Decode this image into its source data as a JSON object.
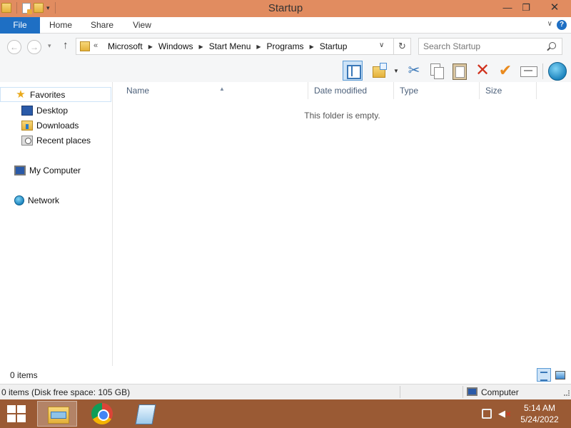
{
  "window": {
    "title": "Startup",
    "controls": {
      "minimize": "—",
      "maximize": "❐",
      "close": "✕"
    }
  },
  "ribbon": {
    "tabs": [
      {
        "label": "File"
      },
      {
        "label": "Home"
      },
      {
        "label": "Share"
      },
      {
        "label": "View"
      }
    ],
    "help": "?"
  },
  "address": {
    "overflow": "«",
    "breadcrumbs": [
      "Microsoft",
      "Windows",
      "Start Menu",
      "Programs",
      "Startup"
    ]
  },
  "search": {
    "placeholder": "Search Startup"
  },
  "toolbar": {
    "icons": [
      "preview-pane-icon",
      "new-folder-icon",
      "cut-icon",
      "copy-icon",
      "paste-icon",
      "delete-icon",
      "check-icon",
      "rename-icon",
      "globe-icon"
    ]
  },
  "navigation": {
    "favorites_label": "Favorites",
    "favorites": [
      {
        "label": "Desktop",
        "icon": "desktop-icon"
      },
      {
        "label": "Downloads",
        "icon": "downloads-icon"
      },
      {
        "label": "Recent places",
        "icon": "recent-places-icon"
      }
    ],
    "computer_label": "My Computer",
    "network_label": "Network"
  },
  "content": {
    "columns": [
      "Name",
      "Date modified",
      "Type",
      "Size"
    ],
    "empty_message": "This folder is empty."
  },
  "status": {
    "item_count": "0 items",
    "disk_info": "0 items (Disk free space: 105 GB)",
    "location": "Computer"
  },
  "taskbar": {
    "apps": [
      "file-explorer",
      "chrome",
      "notepad"
    ],
    "clock": {
      "time": "5:14 AM",
      "date": "5/24/2022"
    }
  },
  "colors": {
    "titlebar": "#e18c60",
    "file_tab": "#1e6fc4",
    "taskbar": "#9a5a34",
    "selection": "#cde3f7"
  }
}
